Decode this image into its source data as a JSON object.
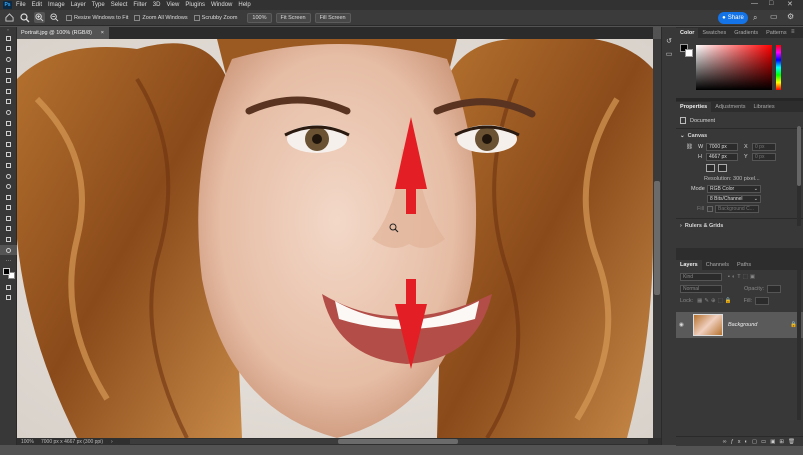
{
  "app": {
    "logo_text": "Ps"
  },
  "menu": [
    "File",
    "Edit",
    "Image",
    "Layer",
    "Type",
    "Select",
    "Filter",
    "3D",
    "View",
    "Plugins",
    "Window",
    "Help"
  ],
  "window_controls": {
    "minimize": "—",
    "maximize": "□",
    "close": "✕"
  },
  "options_bar": {
    "resize_windows": "Resize Windows to Fit",
    "zoom_all_windows": "Zoom All Windows",
    "scrubby_zoom": "Scrubby Zoom",
    "zoom_100": "100%",
    "fit_screen": "Fit Screen",
    "fill_screen": "Fill Screen"
  },
  "share_label": "Share",
  "document": {
    "tab_title": "Portrait.jpg @ 100% (RGB/8)",
    "close": "×"
  },
  "status": {
    "zoom": "100%",
    "info": "7000 px x 4667 px (300 ppi)",
    "arrow": "›"
  },
  "color_panel": {
    "tabs": [
      "Color",
      "Swatches",
      "Gradients",
      "Patterns"
    ],
    "foreground": "#000000",
    "background": "#ffffff"
  },
  "properties_panel": {
    "tabs": [
      "Properties",
      "Adjustments",
      "Libraries"
    ],
    "document_label": "Document",
    "canvas_section": "Canvas",
    "width_label": "W",
    "width_value": "7000 px",
    "height_label": "H",
    "height_value": "4667 px",
    "x_label": "X",
    "x_value": "0 px",
    "y_label": "Y",
    "y_value": "0 px",
    "resolution": "Resolution: 300 pixel...",
    "mode_label": "Mode",
    "mode_value": "RGB Color",
    "bit_value": "8 Bits/Channel",
    "fill_label": "Fill",
    "fill_value": "Background C...",
    "rulers_section": "Rulers & Grids"
  },
  "layers_panel": {
    "tabs": [
      "Layers",
      "Channels",
      "Paths"
    ],
    "kind_label": "Kind",
    "blend_mode": "Normal",
    "opacity_label": "Opacity:",
    "lock_label": "Lock:",
    "fill_label": "Fill:",
    "layer_name": "Background"
  }
}
